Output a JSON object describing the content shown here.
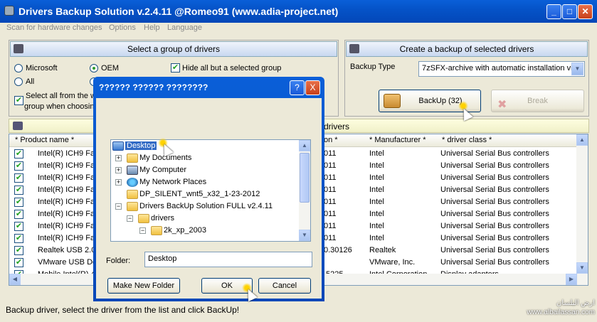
{
  "window": {
    "title": "Drivers Backup Solution v.2.4.11 @Romeo91 (www.adia-project.net)"
  },
  "menu": [
    "Scan for hardware changes",
    "Options",
    "Help",
    "Language"
  ],
  "group_panel": {
    "title": "Select a group of drivers",
    "radio_microsoft": "Microsoft",
    "radio_oem": "OEM",
    "radio_all": "All",
    "hide_all": "Hide all but a selected group",
    "select_all_line1": "Select all from the w",
    "select_all_line2": "group when choosin"
  },
  "backup_panel": {
    "title": "Create a backup of selected drivers",
    "backup_type_label": "Backup Type",
    "backup_type_value": "7zSFX-archive with automatic installation vi",
    "backup_button": "BackUp (32)",
    "break_button": "Break"
  },
  "list_panel": {
    "title_fragment": "drivers"
  },
  "grid": {
    "headers": {
      "product": "* Product name *",
      "version": "on *",
      "manufacturer": "* Manufacturer *",
      "class": "* driver class *"
    },
    "rows": [
      {
        "product": "Intel(R) ICH9 Fa",
        "version": "011",
        "manufacturer": "Intel",
        "class": "Universal Serial Bus controllers"
      },
      {
        "product": "Intel(R) ICH9 Fa",
        "version": "011",
        "manufacturer": "Intel",
        "class": "Universal Serial Bus controllers"
      },
      {
        "product": "Intel(R) ICH9 Fa",
        "version": "011",
        "manufacturer": "Intel",
        "class": "Universal Serial Bus controllers"
      },
      {
        "product": "Intel(R) ICH9 Fa",
        "version": "011",
        "manufacturer": "Intel",
        "class": "Universal Serial Bus controllers"
      },
      {
        "product": "Intel(R) ICH9 Fa",
        "version": "011",
        "manufacturer": "Intel",
        "class": "Universal Serial Bus controllers"
      },
      {
        "product": "Intel(R) ICH9 Fa",
        "version": "011",
        "manufacturer": "Intel",
        "class": "Universal Serial Bus controllers"
      },
      {
        "product": "Intel(R) ICH9 Fa",
        "version": "011",
        "manufacturer": "Intel",
        "class": "Universal Serial Bus controllers"
      },
      {
        "product": "Intel(R) ICH9 Fa",
        "version": "011",
        "manufacturer": "Intel",
        "class": "Universal Serial Bus controllers"
      },
      {
        "product": "Realtek USB 2.0",
        "version": "0.30126",
        "manufacturer": "Realtek",
        "class": "Universal Serial Bus controllers"
      },
      {
        "product": "VMware USB Dev",
        "version": "",
        "manufacturer": "VMware, Inc.",
        "class": "Universal Serial Bus controllers"
      },
      {
        "product": "Mobile Intel(R) 4",
        "version": ".5225",
        "manufacturer": "Intel Corporation",
        "class": "Display adapters"
      }
    ]
  },
  "status": "Backup driver, select the driver from the list and click BackUp!",
  "watermark": {
    "arabic": "ارض البلسان",
    "url": "www.albailassan.com"
  },
  "dialog": {
    "title": "?????? ?????? ????????",
    "help_btn": "?",
    "close_btn": "X",
    "tree": [
      {
        "label": "Desktop",
        "selected": true
      },
      {
        "label": "My Documents"
      },
      {
        "label": "My Computer"
      },
      {
        "label": "My Network Places"
      },
      {
        "label": "DP_SILENT_wnt5_x32_1-23-2012"
      },
      {
        "label": "Drivers BackUp Solution FULL v2.4.11"
      },
      {
        "label": "drivers"
      },
      {
        "label": "2k_xp_2003"
      }
    ],
    "folder_label": "Folder:",
    "folder_value": "Desktop",
    "new_folder": "Make New Folder",
    "ok": "OK",
    "cancel": "Cancel"
  },
  "colors": {
    "accent": "#0a5fd8",
    "selection": "#316ac5",
    "check": "#21a121"
  }
}
